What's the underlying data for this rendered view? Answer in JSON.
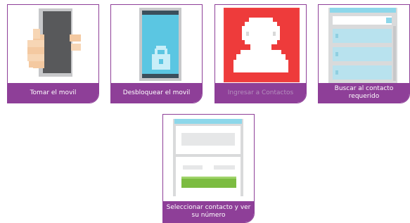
{
  "steps": [
    {
      "label": "Tomar el movil"
    },
    {
      "label": "Desbloquear el movil"
    },
    {
      "label": "Ingresar a Contactos"
    },
    {
      "label": "Buscar al contacto requerido"
    },
    {
      "label": "Seleccionar contacto y ver su número"
    }
  ],
  "colors": {
    "accent": "#8e3f98",
    "phone_dark": "#58595b",
    "screen_blue": "#5bc6e2",
    "contacts_red": "#f04040",
    "list_blue": "#b8e2ee",
    "action_green": "#7cbc41"
  },
  "icons": [
    "hand-holding-phone-icon",
    "unlock-phone-icon",
    "contact-person-icon",
    "contact-list-icon",
    "contact-detail-icon"
  ]
}
